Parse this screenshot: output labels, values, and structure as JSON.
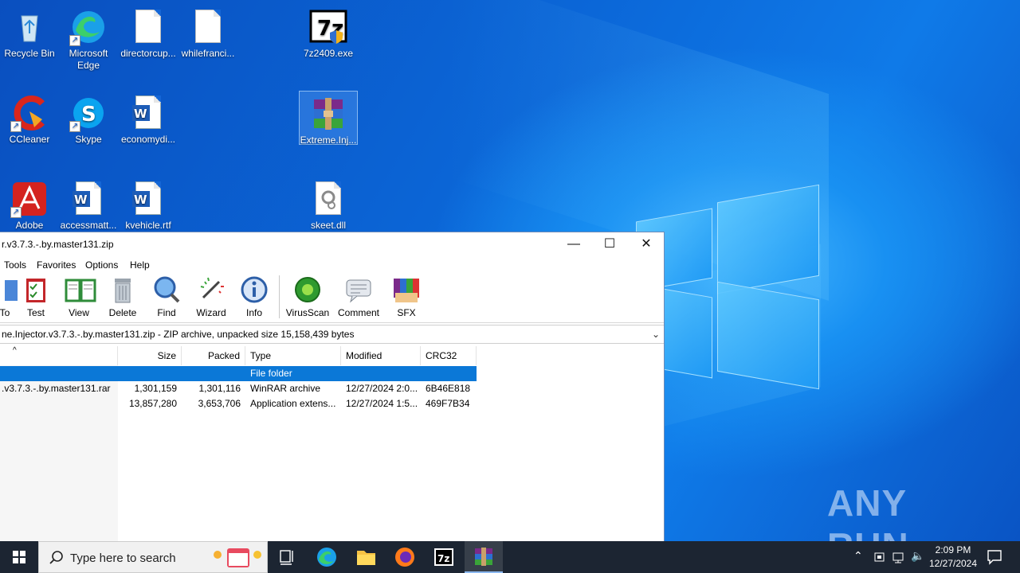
{
  "desktop": {
    "icons": [
      {
        "label": "Recycle Bin"
      },
      {
        "label": "Microsoft Edge"
      },
      {
        "label": "directorcup..."
      },
      {
        "label": "whilefranci..."
      },
      {
        "label": "7z2409.exe"
      },
      {
        "label": "CCleaner"
      },
      {
        "label": "Skype"
      },
      {
        "label": "economydi..."
      },
      {
        "label": "Extreme.Inj..."
      },
      {
        "label": "Adobe"
      },
      {
        "label": "accessmatt..."
      },
      {
        "label": "kvehicle.rtf"
      },
      {
        "label": "skeet.dll"
      }
    ],
    "watermark": "ANY RUN"
  },
  "window": {
    "title": "r.v3.7.3.-.by.master131.zip",
    "controls": {
      "minimize": "—",
      "maximize": "☐",
      "close": "✕"
    },
    "menu": [
      "Tools",
      "Favorites",
      "Options",
      "Help"
    ],
    "toolbar": [
      "To",
      "Test",
      "View",
      "Delete",
      "Find",
      "Wizard",
      "Info",
      "VirusScan",
      "Comment",
      "SFX"
    ],
    "address": "ne.Injector.v3.7.3.-.by.master131.zip - ZIP archive, unpacked size 15,158,439 bytes",
    "columns": [
      "",
      "Size",
      "Packed",
      "Type",
      "Modified",
      "CRC32"
    ],
    "rows": [
      {
        "name": "",
        "size": "",
        "packed": "",
        "type": "File folder",
        "modified": "",
        "crc": ""
      },
      {
        "name": ".v3.7.3.-.by.master131.rar",
        "size": "1,301,159",
        "packed": "1,301,116",
        "type": "WinRAR archive",
        "modified": "12/27/2024 2:0...",
        "crc": "6B46E818"
      },
      {
        "name": "",
        "size": "13,857,280",
        "packed": "3,653,706",
        "type": "Application extens...",
        "modified": "12/27/2024 1:5...",
        "crc": "469F7B34"
      }
    ]
  },
  "taskbar": {
    "search_placeholder": "Type here to search",
    "time": "2:09 PM",
    "date": "12/27/2024"
  }
}
